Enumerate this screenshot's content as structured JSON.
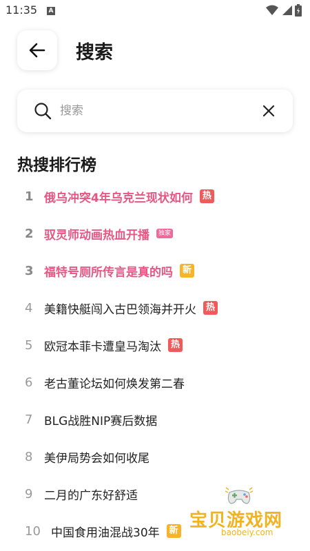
{
  "status_bar": {
    "time": "11:35",
    "notif": "A"
  },
  "header": {
    "back_icon": "arrow-left-icon",
    "title": "搜索"
  },
  "search": {
    "placeholder": "搜索",
    "value": ""
  },
  "section": {
    "title": "热搜排行榜"
  },
  "ranking": [
    {
      "rank": "1",
      "text": "俄乌冲突4年乌克兰现状如何",
      "badge": "热",
      "badge_type": "hot"
    },
    {
      "rank": "2",
      "text": "驭灵师动画热血开播",
      "badge": "独家",
      "badge_type": "exclusive"
    },
    {
      "rank": "3",
      "text": "福特号厕所传言是真的吗",
      "badge": "新",
      "badge_type": "new"
    },
    {
      "rank": "4",
      "text": "美籍快艇闯入古巴领海并开火",
      "badge": "热",
      "badge_type": "hot"
    },
    {
      "rank": "5",
      "text": "欧冠本菲卡遭皇马淘汰",
      "badge": "热",
      "badge_type": "hot"
    },
    {
      "rank": "6",
      "text": "老古董论坛如何焕发第二春",
      "badge": "",
      "badge_type": ""
    },
    {
      "rank": "7",
      "text": "BLG战胜NIP赛后数据",
      "badge": "",
      "badge_type": ""
    },
    {
      "rank": "8",
      "text": "美伊局势会如何收尾",
      "badge": "",
      "badge_type": ""
    },
    {
      "rank": "9",
      "text": "二月的广东好舒适",
      "badge": "",
      "badge_type": ""
    },
    {
      "rank": "10",
      "text": "中国食用油混战30年",
      "badge": "新",
      "badge_type": "new"
    }
  ],
  "watermark": {
    "text": "宝贝游戏网",
    "url": "baobeiy.com"
  },
  "colors": {
    "top_rank_text": "#e65784",
    "hot_badge": "#f05a5a",
    "new_badge": "#f7b32b",
    "exclusive_badge": "#ee6a9a"
  }
}
